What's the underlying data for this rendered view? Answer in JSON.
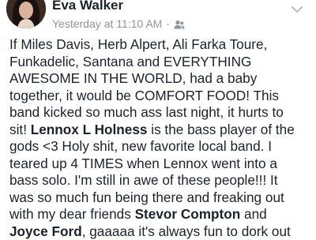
{
  "post": {
    "author": "Eva Walker",
    "timestamp": "Yesterday at 11:10 AM",
    "separator": "·",
    "audience_icon": "friends-icon",
    "menu_icon": "chevron-down-icon",
    "lines": [
      [
        {
          "text": "If Miles Davis, Herb Alpert, Ali Farka Toure,"
        }
      ],
      [
        {
          "text": "Funkadelic, Santana and EVERYTHING"
        }
      ],
      [
        {
          "text": "AWESOME IN THE WORLD, had a baby"
        }
      ],
      [
        {
          "text": "together, it would be COMFORT FOOD! This"
        }
      ],
      [
        {
          "text": "band kicked so much ass last night, it hurts to"
        }
      ],
      [
        {
          "text": "sit! "
        },
        {
          "text": "Lennox L Holness",
          "tag": true
        },
        {
          "text": " is the bass player of the"
        }
      ],
      [
        {
          "text": "gods <3 Holy shit, new favorite local band. I"
        }
      ],
      [
        {
          "text": "teared up 4 TIMES when Lennox went into a"
        }
      ],
      [
        {
          "text": "bass solo. I'm still in awe of these people!!! It"
        }
      ],
      [
        {
          "text": "was so much fun being there and freaking out"
        }
      ],
      [
        {
          "text": "with my dear friends "
        },
        {
          "text": "Stevor Compton",
          "tag": true
        },
        {
          "text": " and"
        }
      ],
      [
        {
          "text": "Joyce Ford",
          "tag": true
        },
        {
          "text": ", gaaaaa it's always fun to dork out"
        }
      ]
    ]
  },
  "colors": {
    "text": "#1d2129",
    "meta": "#90949c",
    "background": "#ffffff"
  }
}
